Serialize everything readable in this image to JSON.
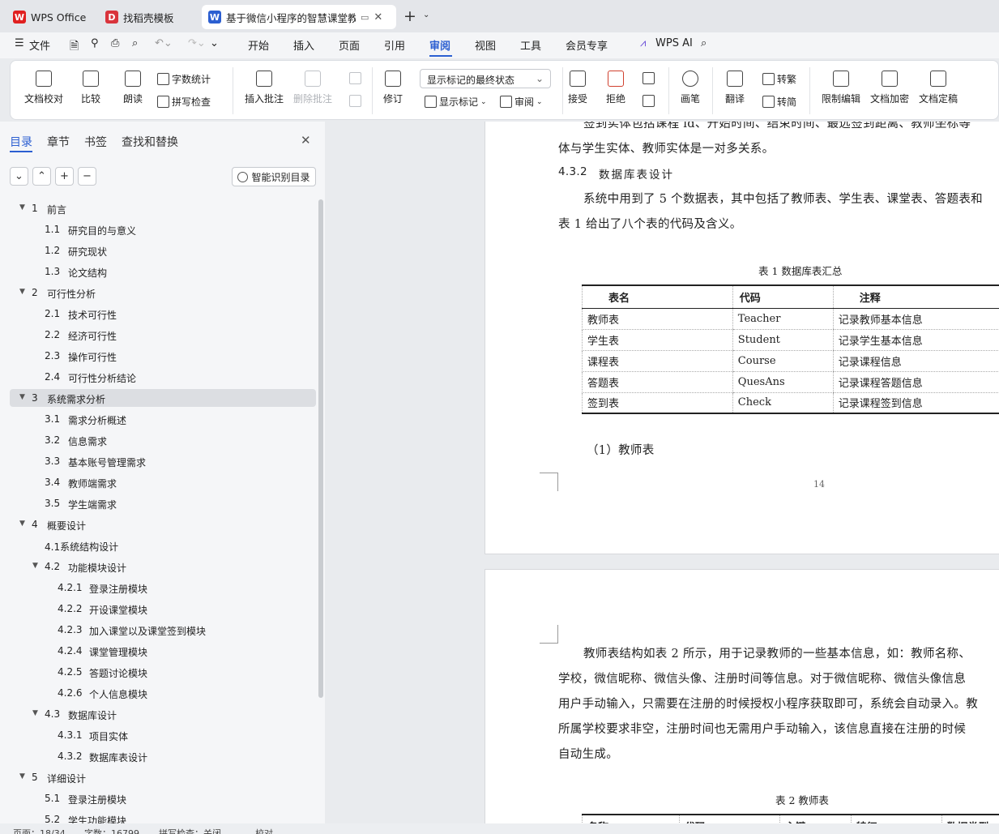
{
  "tabs": [
    {
      "label": "WPS Office",
      "logo": "W",
      "color": "#e02020"
    },
    {
      "label": "找稻壳模板",
      "logo": "D",
      "color": "#d9343c"
    },
    {
      "label": "基于微信小程序的智慧课堂教学",
      "logo": "W",
      "color": "#2c5fd1"
    }
  ],
  "menubar": {
    "file": "文件",
    "items": [
      "开始",
      "插入",
      "页面",
      "引用",
      "审阅",
      "视图",
      "工具",
      "会员专享"
    ],
    "active": "审阅",
    "ai": "WPS AI"
  },
  "ribbon": {
    "proofread": "文档校对",
    "compare": "比较",
    "read": "朗读",
    "wordcount": "字数统计",
    "spellcheck": "拼写检查",
    "insert_comment": "插入批注",
    "delete_comment": "删除批注",
    "revise": "修订",
    "markup_state": "显示标记的最终状态",
    "show_markup": "显示标记",
    "review": "审阅",
    "accept": "接受",
    "reject": "拒绝",
    "pen": "画笔",
    "translate": "翻译",
    "to_traditional": "转繁",
    "to_simplified": "转简",
    "restrict": "限制编辑",
    "encrypt": "文档加密",
    "finalize": "文档定稿"
  },
  "sidebar": {
    "tabs": [
      "目录",
      "章节",
      "书签",
      "查找和替换"
    ],
    "smart_toc": "智能识别目录",
    "toc": [
      {
        "num": "1",
        "title": "前言",
        "level": 1,
        "expanded": true
      },
      {
        "num": "1.1",
        "title": "研究目的与意义",
        "level": 2
      },
      {
        "num": "1.2",
        "title": "研究现状",
        "level": 2
      },
      {
        "num": "1.3",
        "title": "论文结构",
        "level": 2
      },
      {
        "num": "2",
        "title": "可行性分析",
        "level": 1,
        "expanded": true
      },
      {
        "num": "2.1",
        "title": "技术可行性",
        "level": 2
      },
      {
        "num": "2.2",
        "title": "经济可行性",
        "level": 2
      },
      {
        "num": "2.3",
        "title": "操作可行性",
        "level": 2
      },
      {
        "num": "2.4",
        "title": "可行性分析结论",
        "level": 2
      },
      {
        "num": "3",
        "title": "系统需求分析",
        "level": 1,
        "expanded": true,
        "selected": true
      },
      {
        "num": "3.1",
        "title": "需求分析概述",
        "level": 2
      },
      {
        "num": "3.2",
        "title": "信息需求",
        "level": 2
      },
      {
        "num": "3.3",
        "title": "基本账号管理需求",
        "level": 2
      },
      {
        "num": "3.4",
        "title": "教师端需求",
        "level": 2
      },
      {
        "num": "3.5",
        "title": "学生端需求",
        "level": 2
      },
      {
        "num": "4",
        "title": "概要设计",
        "level": 1,
        "expanded": true
      },
      {
        "num": "",
        "title": "4.1系统结构设计",
        "level": 2
      },
      {
        "num": "4.2",
        "title": "功能模块设计",
        "level": 2,
        "expanded": true
      },
      {
        "num": "4.2.1",
        "title": "登录注册模块",
        "level": 3
      },
      {
        "num": "4.2.2",
        "title": "开设课堂模块",
        "level": 3
      },
      {
        "num": "4.2.3",
        "title": "加入课堂以及课堂签到模块",
        "level": 3
      },
      {
        "num": "4.2.4",
        "title": "课堂管理模块",
        "level": 3
      },
      {
        "num": "4.2.5",
        "title": "答题讨论模块",
        "level": 3
      },
      {
        "num": "4.2.6",
        "title": "个人信息模块",
        "level": 3
      },
      {
        "num": "4.3",
        "title": "数据库设计",
        "level": 2,
        "expanded": true
      },
      {
        "num": "4.3.1",
        "title": "项目实体",
        "level": 3
      },
      {
        "num": "4.3.2",
        "title": "数据库表设计",
        "level": 3
      },
      {
        "num": "5",
        "title": "详细设计",
        "level": 1,
        "expanded": true
      },
      {
        "num": "5.1",
        "title": "登录注册模块",
        "level": 2
      },
      {
        "num": "5.2",
        "title": "学生功能模块",
        "level": 2
      }
    ]
  },
  "doc": {
    "p1_line1": "签到实体包括课程 id、开始时间、结束时间、最远签到距离、教师坐标等",
    "p1_line2": "体与学生实体、教师实体是一对多关系。",
    "heading_num": "4.3.2",
    "heading_text": "数据库表设计",
    "p2_line1": "系统中用到了 5 个数据表，其中包括了教师表、学生表、课堂表、答题表和",
    "p2_line2": "表 1 给出了八个表的代码及含义。",
    "table1_caption": "表 1  数据库表汇总",
    "table1_headers": [
      "表名",
      "代码",
      "注释"
    ],
    "table1_rows": [
      [
        "教师表",
        "Teacher",
        "记录教师基本信息"
      ],
      [
        "学生表",
        "Student",
        "记录学生基本信息"
      ],
      [
        "课程表",
        "Course",
        "记录课程信息"
      ],
      [
        "答题表",
        "QuesAns",
        "记录课程答题信息"
      ],
      [
        "签到表",
        "Check",
        "记录课程签到信息"
      ]
    ],
    "subheading": "（1）教师表",
    "page_number": "14",
    "p3_lines": [
      "教师表结构如表 2 所示，用于记录教师的一些基本信息，如：教师名称、",
      "学校，微信昵称、微信头像、注册时间等信息。对于微信昵称、微信头像信息",
      "用户手动输入，只需要在注册的时候授权小程序获取即可，系统会自动录入。教",
      "所属学校要求非空，注册时间也无需用户手动输入，该信息直接在注册的时候",
      "自动生成。"
    ],
    "table2_caption": "表 2  教师表",
    "table2_headers": [
      "名称",
      "代码",
      "主键",
      "特征",
      "数据类型"
    ]
  },
  "status": {
    "page": "页面：18/34",
    "words": "字数：16799",
    "spell": "拼写检查：关闭",
    "proof": "校对"
  }
}
